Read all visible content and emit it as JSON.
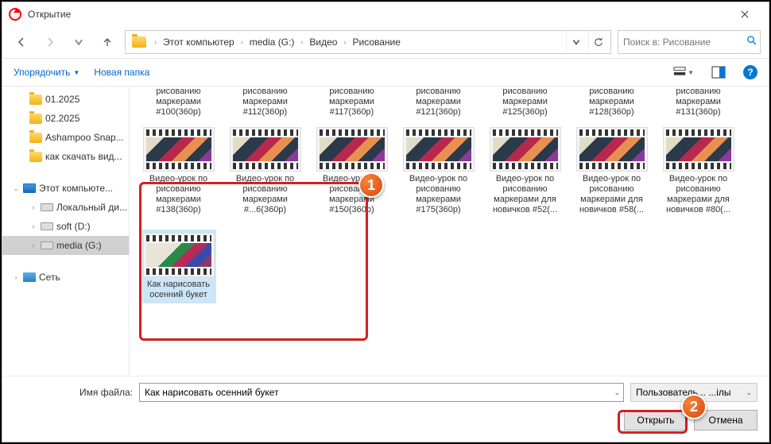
{
  "title": "Открытие",
  "breadcrumb": {
    "items": [
      "Этот компьютер",
      "media (G:)",
      "Видео",
      "Рисование"
    ]
  },
  "search": {
    "placeholder": "Поиск в: Рисование"
  },
  "toolbar": {
    "organize": "Упорядочить",
    "new_folder": "Новая папка"
  },
  "sidebar": {
    "quick": [
      "01.2025",
      "02.2025",
      "Ashampoo Snap...",
      "как скачать вид..."
    ],
    "this_pc": "Этот компьюте...",
    "drives": [
      "Локальный ди...",
      "soft (D:)",
      "media (G:)"
    ],
    "network": "Сеть"
  },
  "row1_captions": [
    "рисованию маркерами #100(360p)",
    "рисованию маркерами #112(360p)",
    "рисованию маркерами #117(360p)",
    "рисованию маркерами #121(360p)",
    "рисованию маркерами #125(360p)",
    "рисованию маркерами #128(360p)",
    "рисованию маркерами #131(360p)"
  ],
  "row2_items": [
    "Видео-урок по рисованию маркерами #138(360p)",
    "Видео-урок по рисованию маркерами #...6(360p)",
    "Видео-урок по рисованию маркерами #150(360p)",
    "Видео-урок по рисованию маркерами #175(360p)",
    "Видео-урок по рисованию маркерами для новичков #52(...",
    "Видео-урок по рисованию маркерами для новичков #58(...",
    "Видео-урок по рисованию маркерами для новичков #80(..."
  ],
  "selected_item": "Как нарисовать осенний букет",
  "filename_label": "Имя файла:",
  "filename_value": "Как нарисовать осенний букет",
  "filter_label": "Пользователь...          ...ілы",
  "open_btn": "Открыть",
  "cancel_btn": "Отмена",
  "callouts": {
    "one": "1",
    "two": "2"
  }
}
